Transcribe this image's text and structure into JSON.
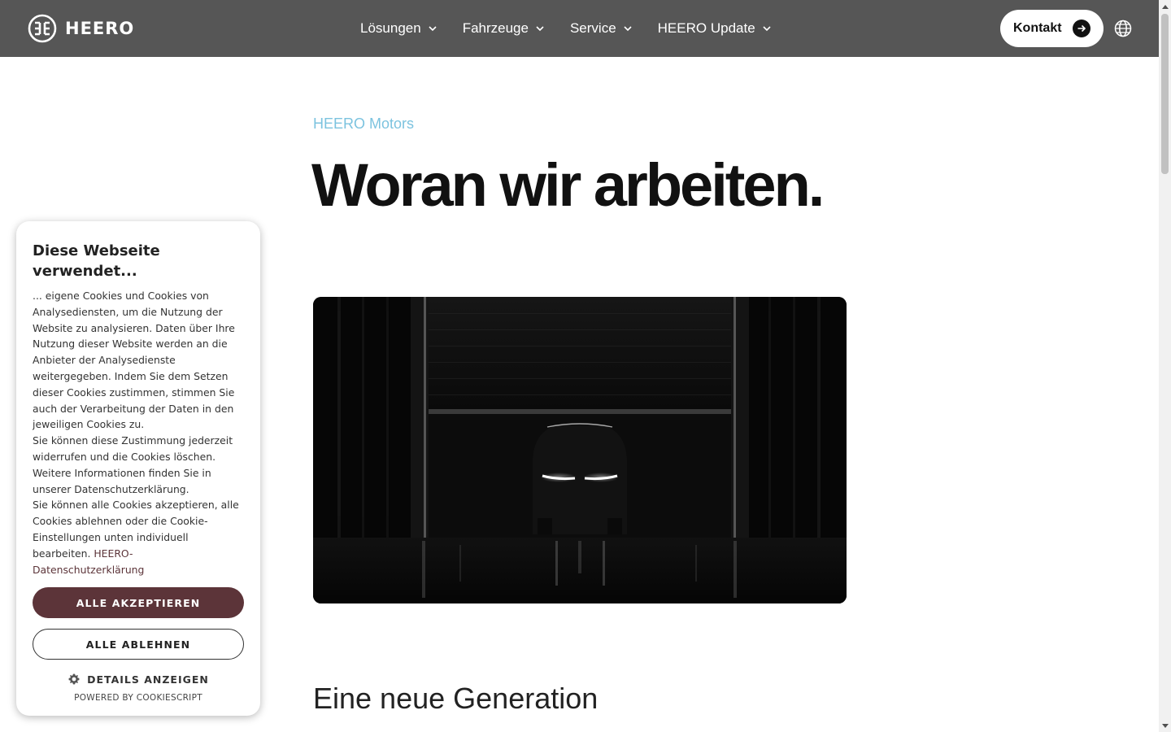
{
  "header": {
    "logo_text": "HEERO",
    "nav": [
      {
        "label": "Lösungen"
      },
      {
        "label": "Fahrzeuge"
      },
      {
        "label": "Service"
      },
      {
        "label": "HEERO Update"
      }
    ],
    "contact_label": "Kontakt",
    "icons": {
      "logo": "heero-logo-mark",
      "chevron": "chevron-down-icon",
      "arrow": "arrow-right-icon",
      "language": "globe-icon"
    }
  },
  "main": {
    "eyebrow": "HEERO Motors",
    "title": "Woran wir arbeiten.",
    "section_title": "Eine neue Generation"
  },
  "cookie_banner": {
    "title": "Diese Webseite verwendet...",
    "paragraph1": "... eigene Cookies und Cookies von Analysediensten, um die Nutzung der Website zu analysieren. Daten über Ihre Nutzung dieser Website werden an die Anbieter der Analysedienste weitergegeben. Indem Sie dem Setzen dieser Cookies zustimmen, stimmen Sie auch der Verarbeitung der Daten in den jeweiligen Cookies zu.",
    "paragraph2": "Sie können diese Zustimmung jederzeit widerrufen und die Cookies löschen. Weitere Informationen finden Sie in unserer Datenschutzerklärung.",
    "paragraph3": "Sie können alle Cookies akzeptieren, alle Cookies ablehnen oder die Cookie-Einstellungen unten individuell bearbeiten.",
    "privacy_link": "HEERO-Datenschutzerklärung",
    "accept_label": "ALLE AKZEPTIEREN",
    "reject_label": "ALLE ABLEHNEN",
    "details_label": "DETAILS ANZEIGEN",
    "powered_by": "POWERED BY COOKIESCRIPT"
  },
  "colors": {
    "navbar": "#565656",
    "eyebrow": "#7cc3df",
    "accept_button": "#5c3439",
    "link": "#5c3439"
  }
}
